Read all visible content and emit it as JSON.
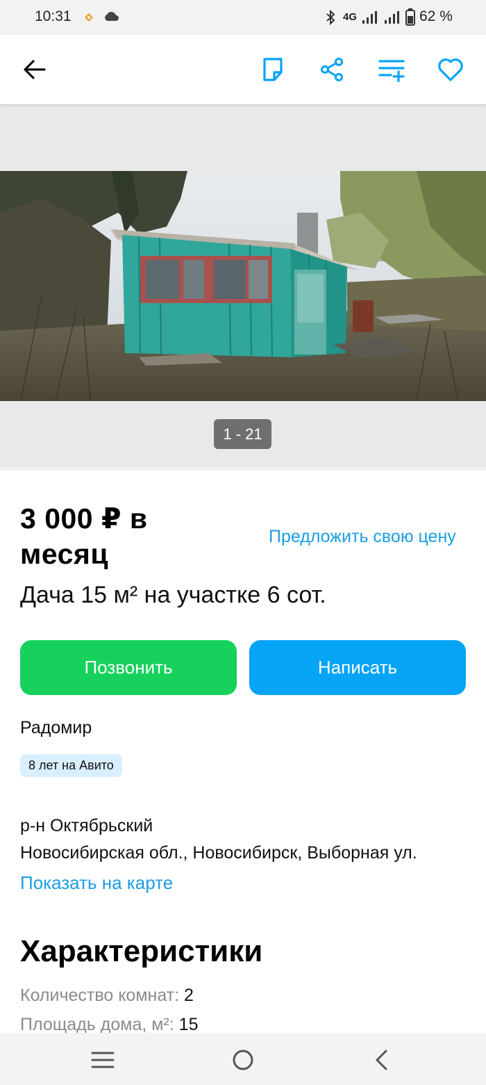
{
  "status": {
    "time": "10:31",
    "network": "4G",
    "battery": "62 %",
    "icons": [
      "notification-icon",
      "cloud-icon",
      "bluetooth-icon",
      "signal-icon",
      "signal-icon",
      "battery-icon"
    ]
  },
  "app_bar": {
    "icons": [
      "back-arrow-icon",
      "note-icon",
      "share-icon",
      "compare-icon",
      "favorite-heart-icon"
    ]
  },
  "gallery": {
    "counter": "1 - 21"
  },
  "listing": {
    "price": "3 000 ₽ в месяц",
    "offer_price": "Предложить свою цену",
    "title": "Дача 15 м² на участке 6 сот.",
    "call_label": "Позвонить",
    "write_label": "Написать"
  },
  "seller": {
    "name": "Радомир",
    "badge": "8 лет на Авито"
  },
  "address": {
    "district": "р-н Октябрьский",
    "full": "Новосибирская обл., Новосибирск, Выборная ул.",
    "map_link": "Показать на карте"
  },
  "characteristics": {
    "title": "Характеристики",
    "rows": [
      {
        "key": "Количество комнат:",
        "value": "2"
      },
      {
        "key": "Площадь дома, м²:",
        "value": "15"
      }
    ]
  },
  "colors": {
    "accent_blue": "#06a4f5",
    "call_green": "#16d25c",
    "link_blue": "#1a9ee3"
  },
  "nav_bar": {
    "icons": [
      "recent-apps-icon",
      "home-icon",
      "back-icon"
    ]
  }
}
